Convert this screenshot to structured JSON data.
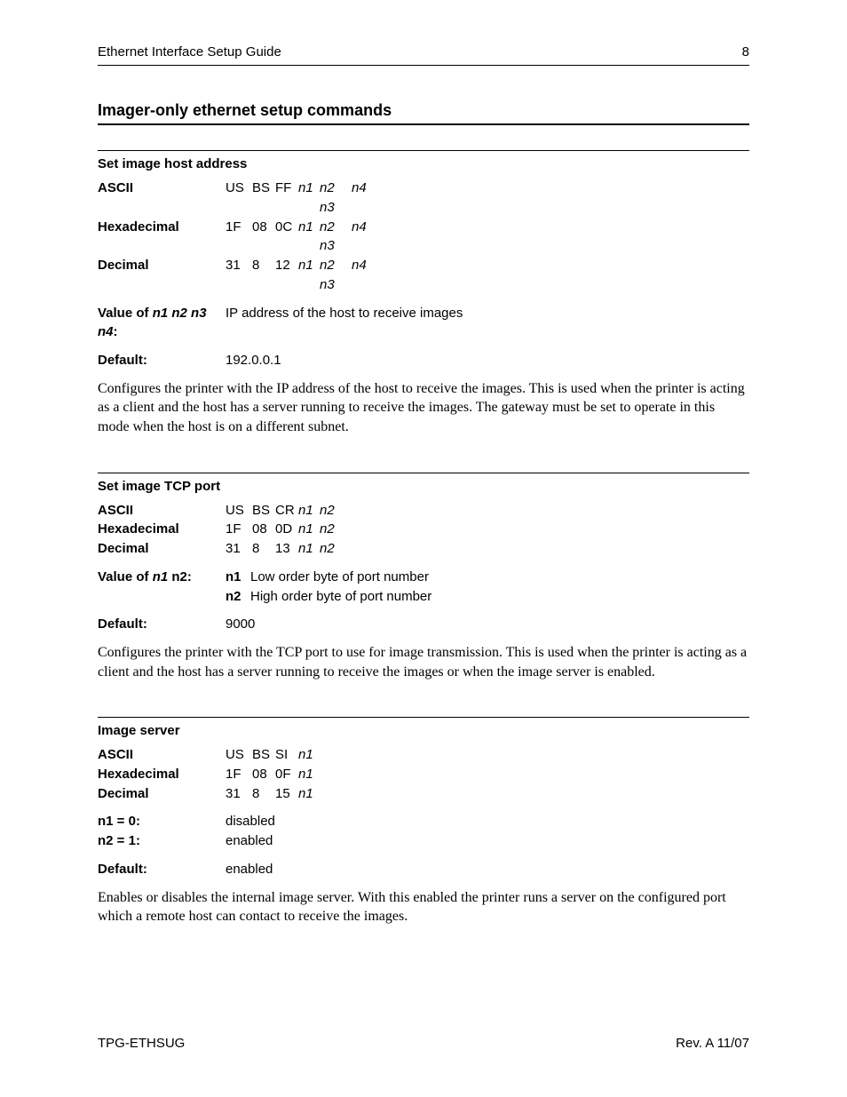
{
  "header": {
    "title": "Ethernet Interface Setup Guide",
    "page": "8"
  },
  "heading": "Imager-only ethernet setup commands",
  "sections": [
    {
      "title": "Set image host address",
      "codes": {
        "ascii": {
          "a": "US",
          "b": "BS",
          "c": "FF",
          "d": "n1",
          "e": "n2 n3",
          "f": "n4"
        },
        "hex": {
          "a": "1F",
          "b": "08",
          "c": "0C",
          "d": "n1",
          "e": "n2 n3",
          "f": "n4"
        },
        "dec": {
          "a": "31",
          "b": "8",
          "c": "12",
          "d": "n1",
          "e": "n2 n3",
          "f": "n4"
        }
      },
      "labels": {
        "ascii": "ASCII",
        "hex": "Hexadecimal",
        "dec": "Decimal"
      },
      "extra": [
        {
          "labelPrefix": "Value of ",
          "labelItalic": "n1 n2 n3 n4",
          "labelSuffix": ":",
          "value": "IP address of the host to receive images"
        },
        {
          "label": "Default:",
          "value": "192.0.0.1"
        }
      ],
      "body": "Configures the printer with the IP address of the host to receive the images. This is used when the printer is acting as a client and the host has a server running to receive the images. The gateway must be set to operate in this mode when the host is on a different subnet."
    },
    {
      "title": "Set image TCP port",
      "codes": {
        "ascii": {
          "a": "US",
          "b": "BS",
          "c": "CR",
          "d": "n1",
          "e": "n2",
          "f": ""
        },
        "hex": {
          "a": "1F",
          "b": "08",
          "c": "0D",
          "d": "n1",
          "e": "n2",
          "f": ""
        },
        "dec": {
          "a": "31",
          "b": "8",
          "c": "13",
          "d": "n1",
          "e": "n2",
          "f": ""
        }
      },
      "labels": {
        "ascii": "ASCII",
        "hex": "Hexadecimal",
        "dec": "Decimal"
      },
      "valueOf": {
        "labelPrefix": "Value of ",
        "labelItalic": "n1",
        "labelSuffix": " n2:",
        "n1key": "n1",
        "n1": "Low order byte of port number",
        "n2key": "n2",
        "n2": "High order byte of port number"
      },
      "default": {
        "label": "Default:",
        "value": "9000"
      },
      "body": "Configures the printer with the TCP port to use for image transmission. This is used when the printer is acting as a client and the host has a server running to receive the images or when the image server is enabled."
    },
    {
      "title": "Image server",
      "codes": {
        "ascii": {
          "a": "US",
          "b": "BS",
          "c": "SI",
          "d": "n1",
          "e": "",
          "f": ""
        },
        "hex": {
          "a": "1F",
          "b": "08",
          "c": "0F",
          "d": "n1",
          "e": "",
          "f": ""
        },
        "dec": {
          "a": "31",
          "b": "8",
          "c": "15",
          "d": "n1",
          "e": "",
          "f": ""
        }
      },
      "labels": {
        "ascii": "ASCII",
        "hex": "Hexadecimal",
        "dec": "Decimal"
      },
      "extra": [
        {
          "label": "n1 = 0:",
          "value": "disabled"
        },
        {
          "label": "n2 = 1:",
          "value": "enabled"
        },
        {
          "label": "Default:",
          "value": "enabled"
        }
      ],
      "body": "Enables or disables the internal image server. With this enabled the printer runs a server on the configured port which a remote host can contact to receive the images."
    }
  ],
  "footer": {
    "left": "TPG-ETHSUG",
    "right": "Rev. A 11/07"
  }
}
